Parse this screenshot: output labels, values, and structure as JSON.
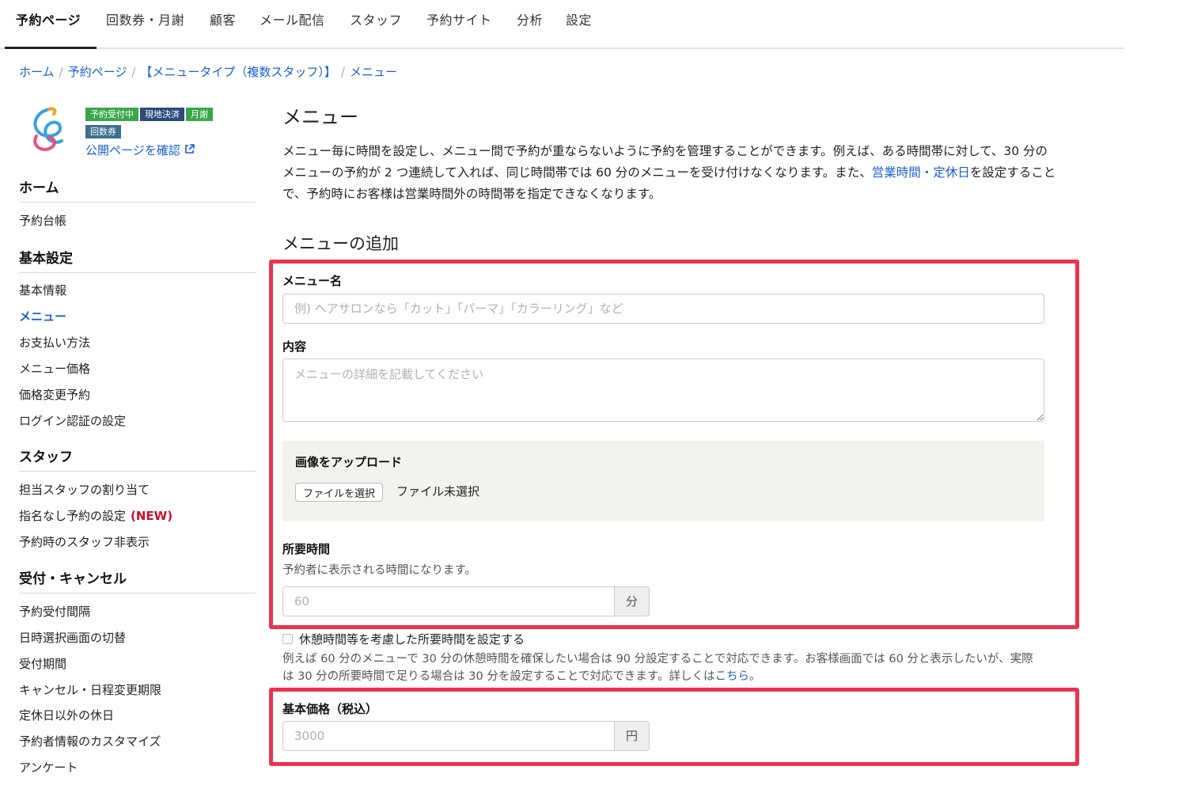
{
  "topnav": {
    "tabs": [
      "予約ページ",
      "回数券・月謝",
      "顧客",
      "メール配信",
      "スタッフ",
      "予約サイト",
      "分析",
      "設定"
    ]
  },
  "breadcrumb": {
    "items": [
      "ホーム",
      "予約ページ",
      "【メニュータイプ（複数スタッフ）】",
      "メニュー"
    ],
    "separator": "/"
  },
  "sidebar": {
    "badges": [
      "予約受付中",
      "現地決済",
      "月謝",
      "回数券"
    ],
    "public_link": "公開ページを確認",
    "sections": [
      {
        "heading": "ホーム",
        "items": [
          "予約台帳"
        ]
      },
      {
        "heading": "基本設定",
        "items": [
          "基本情報",
          "メニュー",
          "お支払い方法",
          "メニュー価格",
          "価格変更予約",
          "ログイン認証の設定"
        ]
      },
      {
        "heading": "スタッフ",
        "items": [
          "担当スタッフの割り当て",
          "指名なし予約の設定",
          "予約時のスタッフ非表示"
        ]
      },
      {
        "heading": "受付・キャンセル",
        "items": [
          "予約受付間隔",
          "日時選択画面の切替",
          "受付期間",
          "キャンセル・日程変更期限",
          "定休日以外の休日",
          "予約者情報のカスタマイズ",
          "アンケート"
        ]
      }
    ],
    "new_label": "(NEW)"
  },
  "main": {
    "title": "メニュー",
    "intro_1": "メニュー毎に時間を設定し、メニュー間で予約が重ならないように予約を管理することができます。例えば、ある時間帯に対して、30 分のメニューの予約が 2 つ連続して入れば、同じ時間帯では 60 分のメニューを受け付けなくなります。また、",
    "intro_link": "営業時間・定休日",
    "intro_2": "を設定することで、予約時にお客様は営業時間外の時間帯を指定できなくなります。",
    "section_title": "メニューの追加",
    "menu_name_label": "メニュー名",
    "menu_name_placeholder": "例) ヘアサロンなら「カット」「パーマ」「カラーリング」など",
    "content_label": "内容",
    "content_placeholder": "メニューの詳細を記載してください",
    "upload_label": "画像をアップロード",
    "file_button": "ファイルを選択",
    "file_status": "ファイル未選択",
    "duration_label": "所要時間",
    "duration_help": "予約者に表示される時間になります。",
    "duration_placeholder": "60",
    "duration_unit": "分",
    "break_checkbox_label": "休憩時間等を考慮した所要時間を設定する",
    "break_note": "例えば 60 分のメニューで 30 分の休憩時間を確保したい場合は 90 分設定することで対応できます。お客様画面では 60 分と表示したいが、実際は 30 分の所要時間で足りる場合は 30 分を設定することで対応できます。詳しくは",
    "break_note_link": "こちら",
    "break_note_end": "。",
    "price_label": "基本価格（税込）",
    "price_placeholder": "3000",
    "price_unit": "円"
  },
  "colors": {
    "link": "#1a5fd6",
    "highlight_border": "#e8334f",
    "badge_green": "#3aa64a",
    "badge_navy": "#2a4a7a",
    "new_red": "#c8102e"
  }
}
